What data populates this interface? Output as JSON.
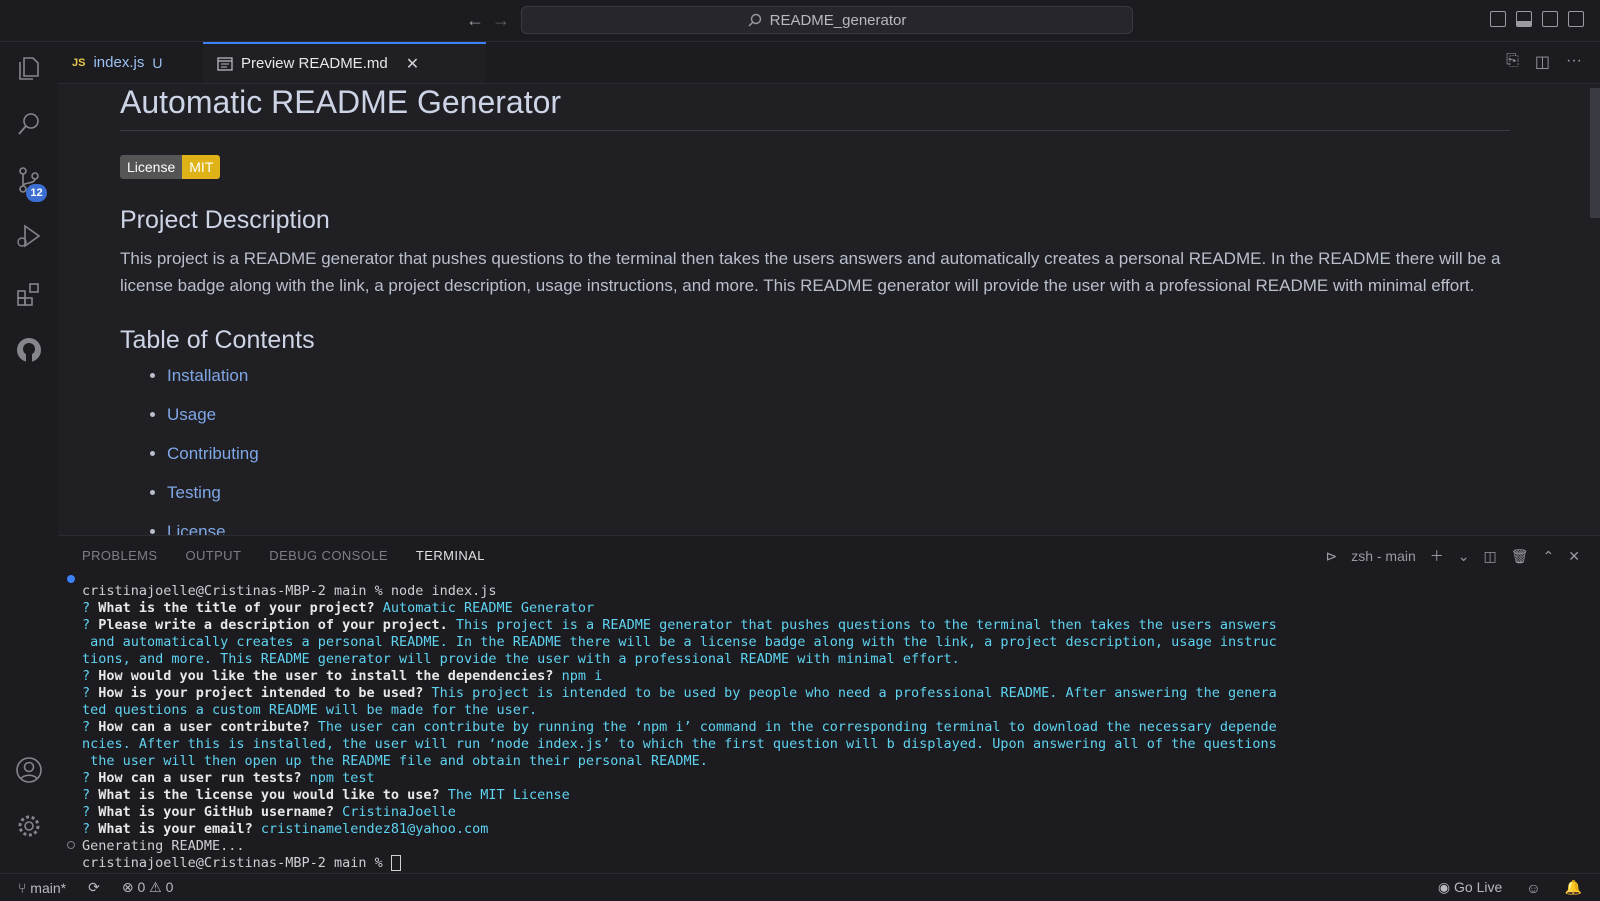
{
  "titlebar": {
    "search_text": "README_generator",
    "back": "←",
    "forward": "→"
  },
  "tabs": [
    {
      "icon": "JS",
      "label": "index.js",
      "modified": "U"
    },
    {
      "label": "Preview README.md",
      "close": "✕"
    }
  ],
  "activity": {
    "source_control_badge": "12"
  },
  "readme": {
    "title": "Automatic README Generator",
    "badge_left": "License",
    "badge_right": "MIT",
    "description_heading": "Project Description",
    "description": "This project is a README generator that pushes questions to the terminal then takes the users answers and automatically creates a personal README. In the README there will be a license badge along with the link, a project description, usage instructions, and more. This README generator will provide the user with a professional README with minimal effort.",
    "toc_heading": "Table of Contents",
    "toc": [
      "Installation",
      "Usage",
      "Contributing",
      "Testing",
      "License"
    ]
  },
  "panel": {
    "tabs": [
      "PROBLEMS",
      "OUTPUT",
      "DEBUG CONSOLE",
      "TERMINAL"
    ],
    "terminal_name": "zsh - main"
  },
  "terminal": {
    "prompt1": "cristinajoelle@Cristinas-MBP-2 main % node index.js",
    "q1": "What is the title of your project?",
    "a1": "Automatic README Generator",
    "q2": "Please write a description of your project.",
    "a2_l1": "This project is a README generator that pushes questions to the terminal then takes the users answers",
    "a2_l2": " and automatically creates a personal README. In the README there will be a license badge along with the link, a project description, usage instruc",
    "a2_l3": "tions, and more. This README generator will provide the user with a professional README with minimal effort.",
    "q3": "How would you like the user to install the dependencies?",
    "a3": "npm i",
    "q4": "How is your project intended to be used?",
    "a4_l1": "This project is intended to be used by people who need a professional README. After answering the genera",
    "a4_l2": "ted questions a custom README will be made for the user.",
    "q5": "How can a user contribute?",
    "a5_l1": "The user can contribute by running the ‘npm i’ command in the corresponding terminal to download the necessary depende",
    "a5_l2": "ncies. After this is installed, the user will run ‘node index.js’ to which the first question will b displayed. Upon answering all of the questions",
    "a5_l3": " the user will then open up the README file and obtain their personal README.",
    "q6": "How can a user run tests?",
    "a6": "npm test",
    "q7": "What is the license you would like to use?",
    "a7": "The MIT License",
    "q8": "What is your GitHub username?",
    "a8": "CristinaJoelle",
    "q9": "What is your email?",
    "a9": "cristinamelendez81@yahoo.com",
    "generating": "Generating README...",
    "prompt2": "cristinajoelle@Cristinas-MBP-2 main % "
  },
  "status": {
    "branch": "main*",
    "errors": "0",
    "warnings": "0",
    "golive": "Go Live"
  },
  "colors": {
    "accent": "#3b82f6",
    "badge_mit": "#dfb317",
    "terminal_cyan": "#5fd3f0"
  }
}
